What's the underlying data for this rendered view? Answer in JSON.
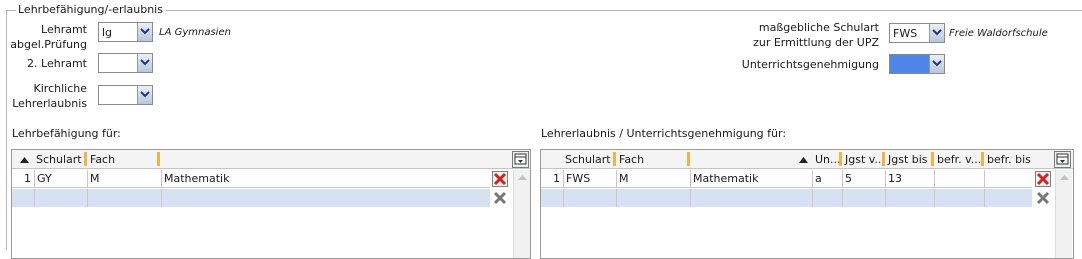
{
  "section": {
    "legend": "Lehrbefähigung/-erlaubnis"
  },
  "form": {
    "lehramt_label_line1": "Lehramt",
    "lehramt_label_line2": "abgel.Prüfung",
    "lehramt_value": "lg",
    "lehramt_desc": "LA Gymnasien",
    "lehramt2_label": "2. Lehramt",
    "lehramt2_value": "",
    "kirchliche_label_line1": "Kirchliche",
    "kirchliche_label_line2": "Lehrerlaubnis",
    "kirchliche_value": "",
    "schulart_label_line1": "maßgebliche Schulart",
    "schulart_label_line2": "zur Ermittlung der UPZ",
    "schulart_value": "FWS",
    "schulart_desc": "Freie Waldorfschule",
    "ugenehmigung_label": "Unterrichtsgenehmigung",
    "ugenehmigung_value": "",
    "ugenehmigung_color": "#4d86e8"
  },
  "left_table": {
    "title": "Lehrbefähigung für:",
    "columns": [
      "Schulart",
      "Fach",
      ""
    ],
    "rows": [
      {
        "index": "1",
        "schulart": "GY",
        "fach": "M",
        "bezeichnung": "Mathematik"
      }
    ]
  },
  "right_table": {
    "title": "Lehrerlaubnis / Unterrichtsgenehmigung für:",
    "columns": [
      "Schulart",
      "Fach",
      "",
      "Un...",
      "Jgst v...",
      "Jgst bis",
      "befr. v...",
      "befr. bis"
    ],
    "rows": [
      {
        "index": "1",
        "schulart": "FWS",
        "fach": "M",
        "bezeichnung": "Mathematik",
        "un": "a",
        "jgst_von": "5",
        "jgst_bis": "13",
        "befr_von": "",
        "befr_bis": ""
      }
    ]
  },
  "icons": {
    "dropdown": "chevron-down-icon",
    "sort": "sort-ascending-icon",
    "delete": "delete-row-icon",
    "delete_inactive": "delete-row-inactive-icon",
    "column_chooser": "column-chooser-icon",
    "scroll_up": "scroll-up-icon"
  },
  "colors": {
    "accent_header": "#f0b24a",
    "selected_row": "#d7e1f1",
    "delete_red": "#d42020"
  }
}
